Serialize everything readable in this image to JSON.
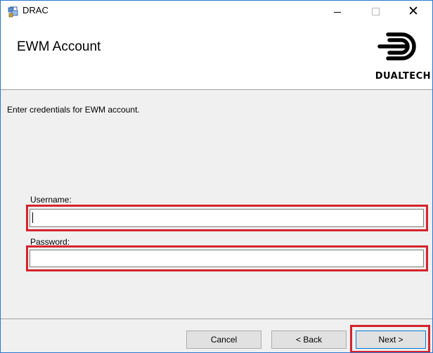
{
  "window": {
    "title": "DRAC",
    "controls": {
      "minimize": "minimize-icon",
      "maximize": "maximize-icon",
      "close": "close-icon"
    }
  },
  "banner": {
    "heading": "EWM Account",
    "logo_text": "DUALTECH"
  },
  "content": {
    "instruction": "Enter credentials for EWM account.",
    "username_label": "Username:",
    "username_value": "",
    "password_label": "Password:",
    "password_value": ""
  },
  "buttons": {
    "cancel": "Cancel",
    "back": "< Back",
    "next": "Next >"
  },
  "colors": {
    "highlight": "#d5232d",
    "focus_border": "#0078d7",
    "window_border": "#2b78d1"
  }
}
